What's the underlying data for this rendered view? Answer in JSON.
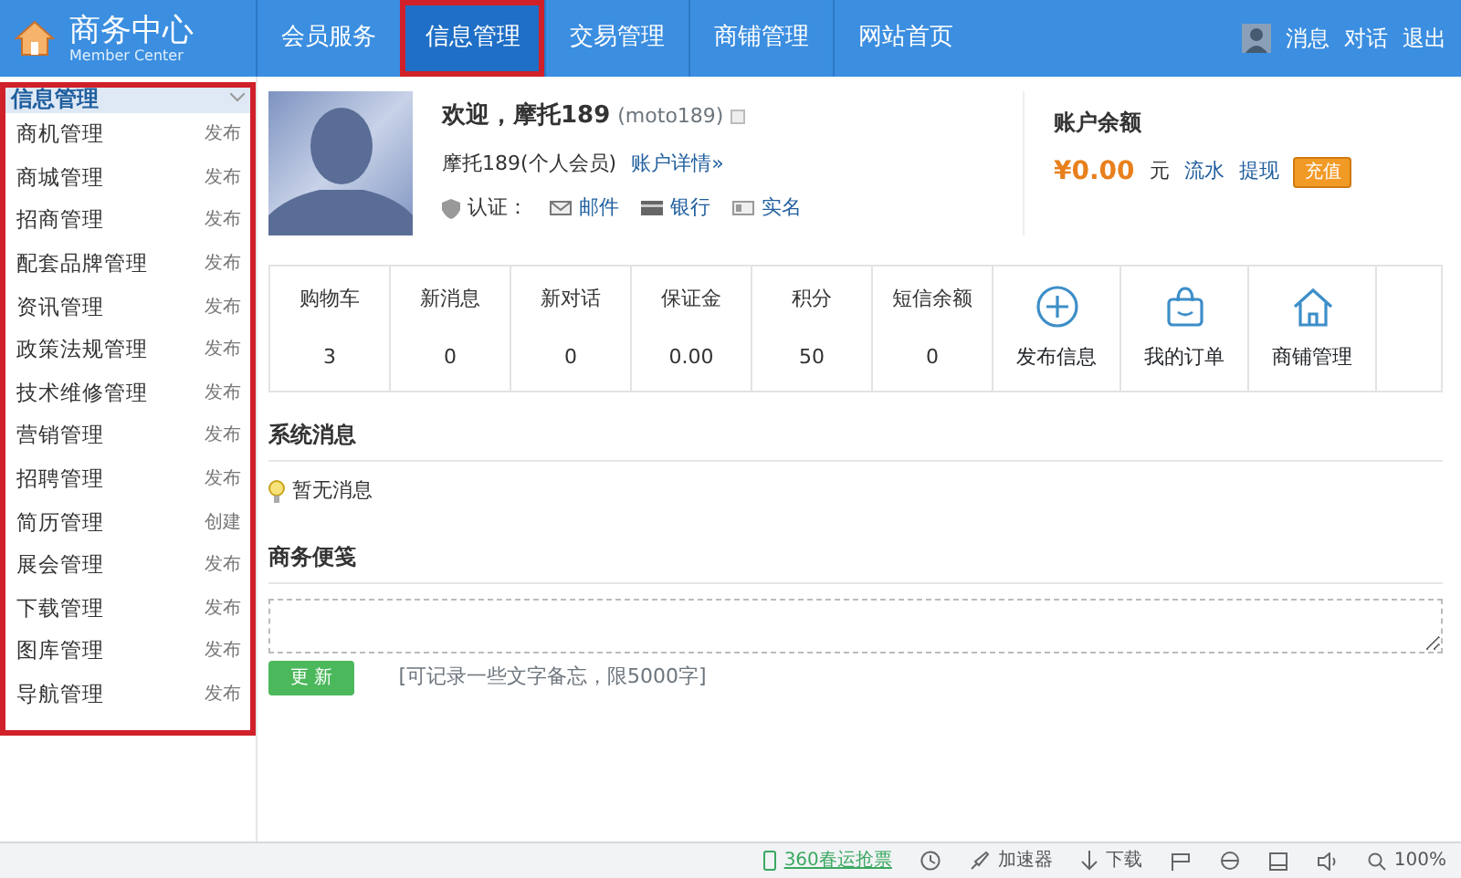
{
  "header": {
    "title": "商务中心",
    "subtitle": "Member Center",
    "nav": [
      {
        "label": "会员服务",
        "selected": false,
        "highlighted": false
      },
      {
        "label": "信息管理",
        "selected": true,
        "highlighted": true
      },
      {
        "label": "交易管理",
        "selected": false,
        "highlighted": false
      },
      {
        "label": "商铺管理",
        "selected": false,
        "highlighted": false
      },
      {
        "label": "网站首页",
        "selected": false,
        "highlighted": false
      }
    ],
    "links": [
      "消息",
      "对话",
      "退出"
    ]
  },
  "sidebar": {
    "title": "信息管理",
    "highlighted": true,
    "items": [
      {
        "label": "商机管理",
        "action": "发布"
      },
      {
        "label": "商城管理",
        "action": "发布"
      },
      {
        "label": "招商管理",
        "action": "发布"
      },
      {
        "label": "配套品牌管理",
        "action": "发布"
      },
      {
        "label": "资讯管理",
        "action": "发布"
      },
      {
        "label": "政策法规管理",
        "action": "发布"
      },
      {
        "label": "技术维修管理",
        "action": "发布"
      },
      {
        "label": "营销管理",
        "action": "发布"
      },
      {
        "label": "招聘管理",
        "action": "发布"
      },
      {
        "label": "简历管理",
        "action": "创建"
      },
      {
        "label": "展会管理",
        "action": "发布"
      },
      {
        "label": "下载管理",
        "action": "发布"
      },
      {
        "label": "图库管理",
        "action": "发布"
      },
      {
        "label": "导航管理",
        "action": "发布"
      }
    ]
  },
  "profile": {
    "welcome": "欢迎，摩托189",
    "username": "(moto189)",
    "member": "摩托189(个人会员)",
    "details_link": "账户详情»",
    "verify_label": "认证：",
    "verifications": [
      "邮件",
      "银行",
      "实名"
    ]
  },
  "balance": {
    "title": "账户余额",
    "amount": "¥0.00",
    "unit": "元",
    "links": [
      "流水",
      "提现"
    ],
    "button": "充值"
  },
  "stats": [
    {
      "kind": "stat",
      "label": "购物车",
      "value": "3"
    },
    {
      "kind": "stat",
      "label": "新消息",
      "value": "0"
    },
    {
      "kind": "stat",
      "label": "新对话",
      "value": "0"
    },
    {
      "kind": "stat",
      "label": "保证金",
      "value": "0.00"
    },
    {
      "kind": "stat",
      "label": "积分",
      "value": "50"
    },
    {
      "kind": "stat",
      "label": "短信余额",
      "value": "0"
    },
    {
      "kind": "plus",
      "label": "发布信息"
    },
    {
      "kind": "bag",
      "label": "我的订单"
    },
    {
      "kind": "home",
      "label": "商铺管理"
    }
  ],
  "system_messages": {
    "title": "系统消息",
    "empty": "暂无消息"
  },
  "notes": {
    "title": "商务便笺",
    "button": "更 新",
    "hint": "[可记录一些文字备忘，限5000字]"
  },
  "status_bar": {
    "promo": "360春运抢票",
    "accelerator": "加速器",
    "download": "下载",
    "zoom": "100%"
  }
}
